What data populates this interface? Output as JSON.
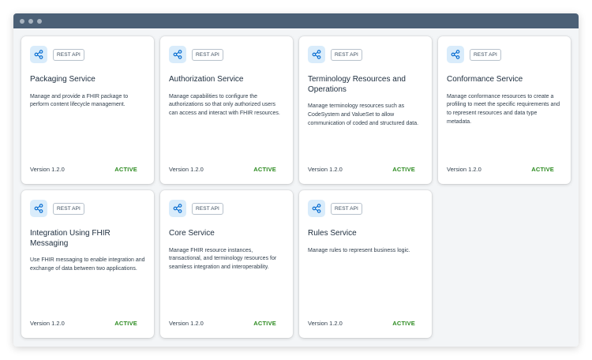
{
  "cards": [
    {
      "icon": "share-icon",
      "badge": "REST API",
      "title": "Packaging Service",
      "description": "Manage and provide a FHIR package to perform content lifecycle management.",
      "version": "Version 1.2.0",
      "status": "ACTIVE"
    },
    {
      "icon": "share-icon",
      "badge": "REST API",
      "title": "Authorization Service",
      "description": "Manage capabilities to configure the authorizations so that only authorized users can access and interact with FHIR resources.",
      "version": "Version 1.2.0",
      "status": "ACTIVE"
    },
    {
      "icon": "share-icon",
      "badge": "REST API",
      "title": "Terminology Resources and Operations",
      "description": "Manage terminology resources such as CodeSystem and ValueSet to allow communication of coded and structured data.",
      "version": "Version 1.2.0",
      "status": "ACTIVE"
    },
    {
      "icon": "share-icon",
      "badge": "REST API",
      "title": "Conformance Service",
      "description": "Manage conformance resources to create a profiling to meet the specific requirements and to represent resources and data type metadata.",
      "version": "Version 1.2.0",
      "status": "ACTIVE"
    },
    {
      "icon": "share-icon",
      "badge": "REST API",
      "title": "Integration Using FHIR Messaging",
      "description": "Use FHIR messaging to enable integration and exchange of data between two applications.",
      "version": "Version 1.2.0",
      "status": "ACTIVE"
    },
    {
      "icon": "share-icon",
      "badge": "REST API",
      "title": "Core Service",
      "description": "Manage FHIR resource instances, transactional, and terminology resources for seamless integration and interoperability.",
      "version": "Version 1.2.0",
      "status": "ACTIVE"
    },
    {
      "icon": "share-icon",
      "badge": "REST API",
      "title": "Rules Service",
      "description": "Manage rules to represent business logic.",
      "version": "Version 1.2.0",
      "status": "ACTIVE"
    }
  ],
  "colors": {
    "titlebar": "#4b6076",
    "icon_tile": "#d9ecfb",
    "icon_stroke": "#0a6ed1",
    "status_active": "#2b8a1f"
  }
}
